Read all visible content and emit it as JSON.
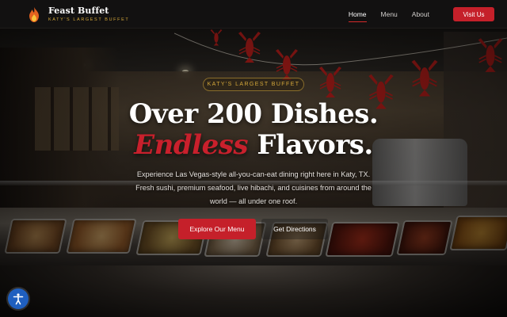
{
  "nav": {
    "brand_name": "Feast Buffet",
    "brand_tagline": "KATY'S LARGEST BUFFET",
    "links": [
      {
        "label": "Home",
        "active": true
      },
      {
        "label": "Menu",
        "active": false
      },
      {
        "label": "About",
        "active": false
      }
    ],
    "cta_label": "Visit Us"
  },
  "hero": {
    "badge": "KATY'S LARGEST BUFFET",
    "headline_line1": "Over 200 Dishes.",
    "headline_accent": "Endless",
    "headline_rest": " Flavors.",
    "subtext": "Experience Las Vegas-style all-you-can-eat dining right here in Katy, TX. Fresh sushi, premium seafood, live hibachi, and cuisines from around the world — all under one roof.",
    "primary_button": "Explore Our Menu",
    "secondary_button": "Get Directions"
  },
  "colors": {
    "accent_red": "#c5202a",
    "gold": "#d4a73a",
    "nav_background": "#121111"
  },
  "icons": {
    "logo": "flame-icon",
    "accessibility": "accessibility-icon"
  }
}
